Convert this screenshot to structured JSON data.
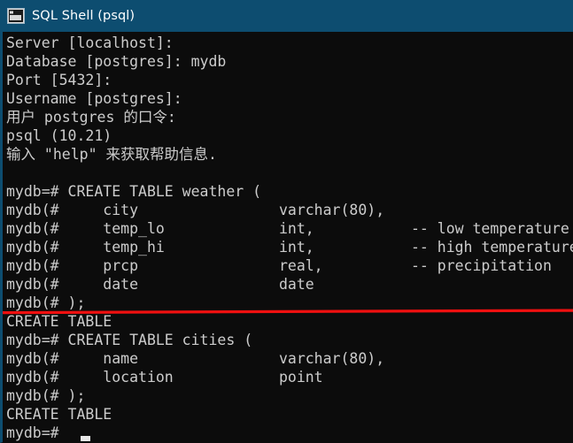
{
  "window": {
    "title": "SQL Shell (psql)",
    "icon": "console-window-icon",
    "titlebar_color": "#0d4d70",
    "terminal_background": "#0c0c0c",
    "terminal_foreground": "#cccccc"
  },
  "annotation": {
    "name": "red-underline",
    "color": "#f01010",
    "target_text": "CREATE TABLE"
  },
  "terminal": {
    "lines": [
      "Server [localhost]:",
      "Database [postgres]: mydb",
      "Port [5432]:",
      "Username [postgres]:",
      "用户 postgres 的口令:",
      "psql (10.21)",
      "输入 \"help\" 来获取帮助信息.",
      "",
      "mydb=# CREATE TABLE weather (",
      "mydb(#     city                varchar(80),",
      "mydb(#     temp_lo             int,           -- low temperature",
      "mydb(#     temp_hi             int,           -- high temperature",
      "mydb(#     prcp                real,          -- precipitation",
      "mydb(#     date                date",
      "mydb(# );",
      "CREATE TABLE",
      "mydb=# CREATE TABLE cities (",
      "mydb(#     name                varchar(80),",
      "mydb(#     location            point",
      "mydb(# );",
      "CREATE TABLE",
      "mydb=# "
    ],
    "prompt_primary": "mydb=#",
    "prompt_continuation": "mydb(#",
    "cursor": {
      "name": "text-cursor",
      "line_index": 21,
      "column": 7
    }
  }
}
